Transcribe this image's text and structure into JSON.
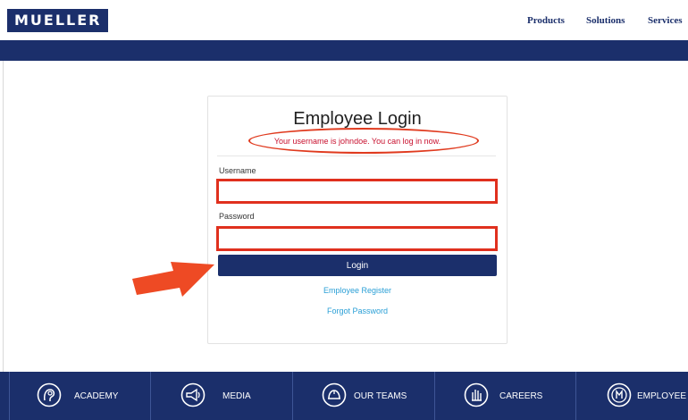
{
  "header": {
    "logo": "MUELLER",
    "nav": [
      {
        "label": "Products"
      },
      {
        "label": "Solutions"
      },
      {
        "label": "Services"
      }
    ]
  },
  "login": {
    "title": "Employee Login",
    "flash_message": "Your username is johndoe. You can log in now.",
    "username_label": "Username",
    "username_value": "",
    "password_label": "Password",
    "password_value": "",
    "submit_label": "Login",
    "register_link": "Employee Register",
    "forgot_link": "Forgot Password"
  },
  "footer": {
    "items": [
      {
        "label": "ACADEMY",
        "icon": "academy-icon"
      },
      {
        "label": "MEDIA",
        "icon": "megaphone-icon"
      },
      {
        "label": "OUR TEAMS",
        "icon": "hardhat-icon"
      },
      {
        "label": "CAREERS",
        "icon": "hand-icon"
      },
      {
        "label": "EMPLOYEE",
        "icon": "employee-logo-icon"
      }
    ]
  },
  "colors": {
    "brand_navy": "#1b2f6b",
    "error_red": "#c8102e",
    "annotation_red": "#e0301e",
    "link_blue": "#2a9fd6"
  }
}
